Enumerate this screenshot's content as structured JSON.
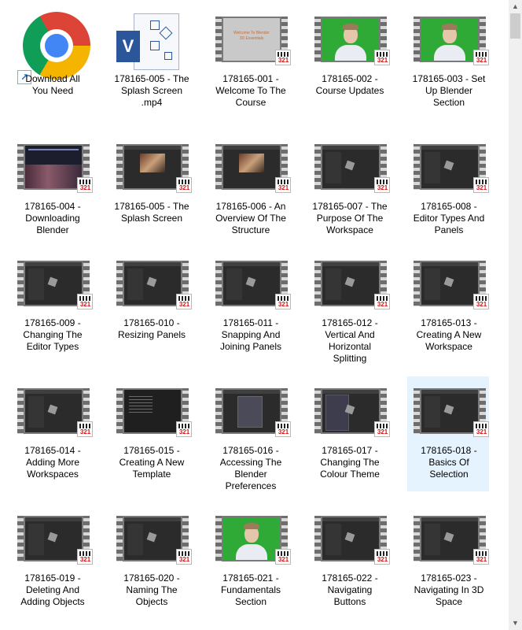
{
  "files": [
    {
      "label": "Download All\nYou Need",
      "kind": "chrome",
      "selected": false
    },
    {
      "label": "178165-005 - The\nSplash Screen\n.mp4",
      "kind": "visio",
      "selected": false
    },
    {
      "label": "178165-001 -\nWelcome To The\nCourse",
      "kind": "title",
      "selected": false
    },
    {
      "label": "178165-002 -\nCourse Updates",
      "kind": "green",
      "selected": false
    },
    {
      "label": "178165-003 - Set\nUp Blender\nSection",
      "kind": "green",
      "selected": false
    },
    {
      "label": "178165-004 -\nDownloading\nBlender",
      "kind": "web",
      "selected": false
    },
    {
      "label": "178165-005 - The\nSplash Screen",
      "kind": "splash",
      "selected": false
    },
    {
      "label": "178165-006 - An\nOverview Of The\nStructure",
      "kind": "splash",
      "selected": false
    },
    {
      "label": "178165-007 - The\nPurpose Of The\nWorkspace",
      "kind": "dark",
      "selected": false
    },
    {
      "label": "178165-008 -\nEditor Types And\nPanels",
      "kind": "dark",
      "selected": false
    },
    {
      "label": "178165-009 -\nChanging The\nEditor Types",
      "kind": "dark",
      "selected": false
    },
    {
      "label": "178165-010 -\nResizing Panels",
      "kind": "dark",
      "selected": false
    },
    {
      "label": "178165-011 -\nSnapping And\nJoining Panels",
      "kind": "dark",
      "selected": false
    },
    {
      "label": "178165-012 -\nVertical And\nHorizontal\nSplitting",
      "kind": "dark",
      "selected": false
    },
    {
      "label": "178165-013 -\nCreating A New\nWorkspace",
      "kind": "dark",
      "selected": false
    },
    {
      "label": "178165-014 -\nAdding More\nWorkspaces",
      "kind": "dark",
      "selected": false
    },
    {
      "label": "178165-015 -\nCreating A New\nTemplate",
      "kind": "code",
      "selected": false
    },
    {
      "label": "178165-016 -\nAccessing The\nBlender\nPreferences",
      "kind": "prefs",
      "selected": false
    },
    {
      "label": "178165-017 -\nChanging The\nColour Theme",
      "kind": "theme",
      "selected": false
    },
    {
      "label": "178165-018 -\nBasics Of\nSelection",
      "kind": "dark",
      "selected": true
    },
    {
      "label": "178165-019 -\nDeleting And\nAdding Objects",
      "kind": "dark",
      "selected": false
    },
    {
      "label": "178165-020 -\nNaming The\nObjects",
      "kind": "dark",
      "selected": false
    },
    {
      "label": "178165-021 -\nFundamentals\nSection",
      "kind": "green",
      "selected": false
    },
    {
      "label": "178165-022 -\nNavigating\nButtons",
      "kind": "dark",
      "selected": false
    },
    {
      "label": "178165-023 -\nNavigating In 3D\nSpace",
      "kind": "dark",
      "selected": false
    }
  ],
  "title_slide_text": "Welcome To Blender\n3D Essentials",
  "video_badge_text": "321",
  "visio_letter": "V",
  "shortcut_glyph": "↗",
  "scrollbar": {
    "up_glyph": "▲",
    "down_glyph": "▼"
  }
}
